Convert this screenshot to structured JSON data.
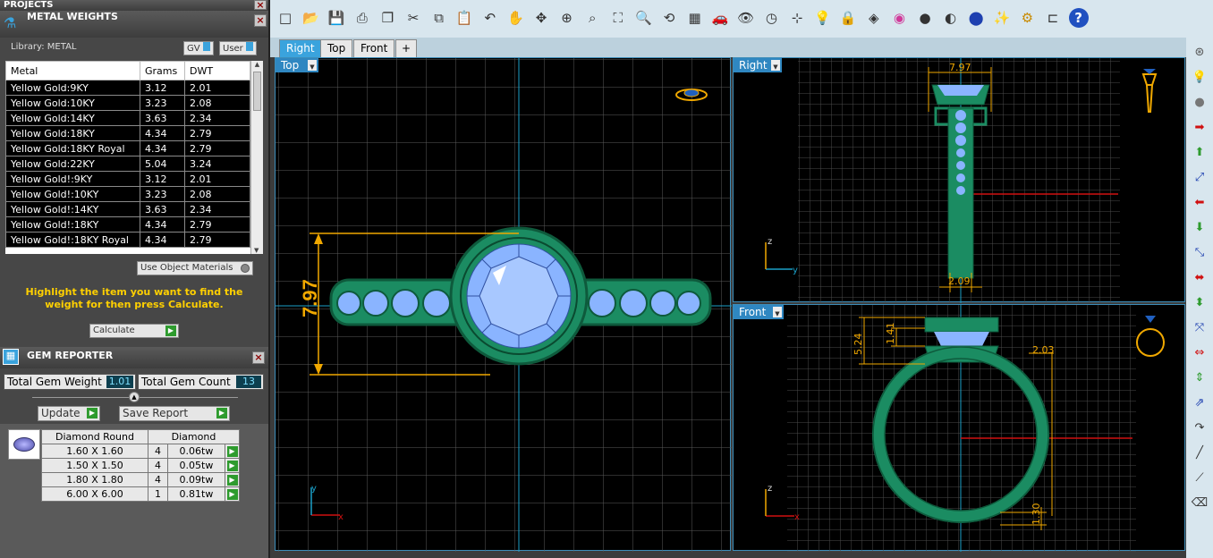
{
  "projects_title": "PROJECTS",
  "metal_panel": {
    "title": "METAL WEIGHTS",
    "library": "Library: METAL",
    "gv_label": "GV",
    "user_label": "User",
    "headers": [
      "Metal",
      "Grams",
      "DWT"
    ],
    "rows": [
      [
        "Yellow Gold:9KY",
        "3.12",
        "2.01"
      ],
      [
        "Yellow Gold:10KY",
        "3.23",
        "2.08"
      ],
      [
        "Yellow Gold:14KY",
        "3.63",
        "2.34"
      ],
      [
        "Yellow Gold:18KY",
        "4.34",
        "2.79"
      ],
      [
        "Yellow Gold:18KY Royal",
        "4.34",
        "2.79"
      ],
      [
        "Yellow Gold:22KY",
        "5.04",
        "3.24"
      ],
      [
        "Yellow Gold!:9KY",
        "3.12",
        "2.01"
      ],
      [
        "Yellow Gold!:10KY",
        "3.23",
        "2.08"
      ],
      [
        "Yellow Gold!:14KY",
        "3.63",
        "2.34"
      ],
      [
        "Yellow Gold!:18KY",
        "4.34",
        "2.79"
      ],
      [
        "Yellow Gold!:18KY Royal",
        "4.34",
        "2.79"
      ]
    ],
    "use_object_materials": "Use Object Materials",
    "hint": "Highlight the item you want to find the weight for then press Calculate.",
    "calculate": "Calculate"
  },
  "gem_panel": {
    "title": "GEM REPORTER",
    "total_weight_label": "Total Gem Weight",
    "total_weight": "1.01",
    "total_count_label": "Total Gem Count",
    "total_count": "13",
    "update": "Update",
    "save_report": "Save Report",
    "gem_header": "Diamond Round",
    "material_header": "Diamond",
    "rows": [
      [
        "1.60 X 1.60",
        "4",
        "0.06tw"
      ],
      [
        "1.50 X 1.50",
        "4",
        "0.05tw"
      ],
      [
        "1.80 X 1.80",
        "4",
        "0.09tw"
      ],
      [
        "6.00 X 6.00",
        "1",
        "0.81tw"
      ]
    ]
  },
  "tabs": [
    "Right",
    "Top",
    "Front"
  ],
  "viewports": {
    "top": {
      "label": "Top",
      "dim": "7.97"
    },
    "right": {
      "label": "Right",
      "dim_top": "7.97",
      "dim_bottom": "2.09"
    },
    "front": {
      "label": "Front",
      "dim_a": "5.24",
      "dim_b": "1.41",
      "dim_c": "2.03",
      "dim_d": "1.30"
    }
  },
  "colors": {
    "ring": "#1b8c62",
    "gem": "#8ab4ff",
    "dim": "#f0a800",
    "axis_red": "#d01010",
    "axis_blue": "#1aa0c8"
  }
}
